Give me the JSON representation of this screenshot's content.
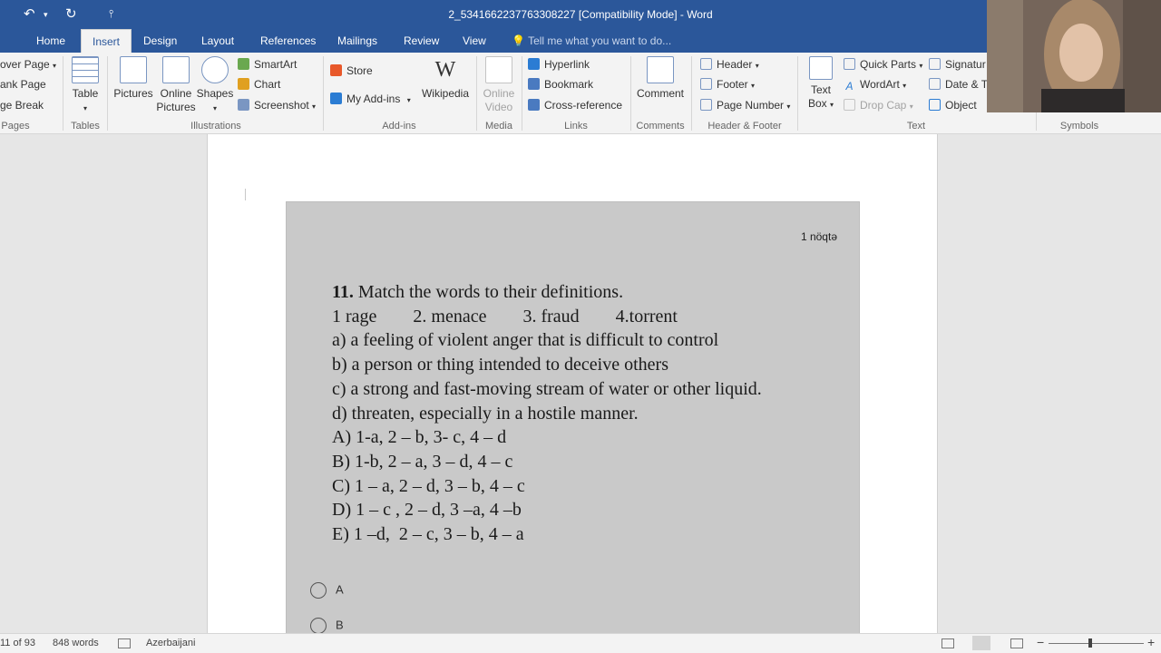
{
  "window": {
    "title": "2_5341662237763308227 [Compatibility Mode] - Word",
    "qat_undo": "↶",
    "qat_redo": "↻",
    "qat_customize": "⫯"
  },
  "tabs": {
    "items": [
      "Home",
      "Insert",
      "Design",
      "Layout",
      "References",
      "Mailings",
      "Review",
      "View"
    ],
    "active": "Insert",
    "tell_me": "Tell me what you want to do..."
  },
  "ribbon": {
    "pages": {
      "cover_page": "over Page",
      "blank_page": "ank Page",
      "page_break": "ge Break",
      "label": "Pages"
    },
    "tables": {
      "table": "Table",
      "label": "Tables"
    },
    "illustrations": {
      "pictures": "Pictures",
      "online_pictures_1": "Online",
      "online_pictures_2": "Pictures",
      "shapes": "Shapes",
      "smartart": "SmartArt",
      "chart": "Chart",
      "screenshot": "Screenshot",
      "label": "Illustrations"
    },
    "addins": {
      "store": "Store",
      "my_addins": "My Add-ins",
      "wikipedia": "Wikipedia",
      "label": "Add-ins"
    },
    "media": {
      "online_video_1": "Online",
      "online_video_2": "Video",
      "label": "Media"
    },
    "links": {
      "hyperlink": "Hyperlink",
      "bookmark": "Bookmark",
      "cross_reference": "Cross-reference",
      "label": "Links"
    },
    "comments": {
      "comment": "Comment",
      "label": "Comments"
    },
    "header_footer": {
      "header": "Header",
      "footer": "Footer",
      "page_number": "Page Number",
      "label": "Header & Footer"
    },
    "text": {
      "text_box_1": "Text",
      "text_box_2": "Box",
      "quick_parts": "Quick Parts",
      "wordart": "WordArt",
      "drop_cap": "Drop Cap",
      "signature": "Signatur",
      "date_time": "Date & T",
      "object": "Object",
      "label": "Text"
    },
    "symbols": {
      "label": "Symbols"
    }
  },
  "document": {
    "points": "1 nöqtə",
    "question_lines": [
      "11. Match the words to their definitions.",
      "1 rage        2. menace        3. fraud        4.torrent",
      "a) a feeling of violent anger that is difficult to control",
      "b) a person or thing intended to deceive others",
      "c) a strong and fast-moving stream of water or other liquid.",
      "d) threaten, especially in a hostile manner.",
      "A) 1-a, 2 – b, 3- c, 4 – d",
      "B) 1-b, 2 – a, 3 – d, 4 – c",
      "C) 1 – a, 2 – d, 3 – b, 4 – c",
      "D) 1 – c , 2 – d, 3 –a, 4 –b",
      "E) 1 –d,  2 – c, 3 – b, 4 – a"
    ],
    "options": [
      "A",
      "B"
    ]
  },
  "status": {
    "page": "11 of 93",
    "words": "848 words",
    "language": "Azerbaijani"
  },
  "colors": {
    "accent": "#2b579a"
  }
}
